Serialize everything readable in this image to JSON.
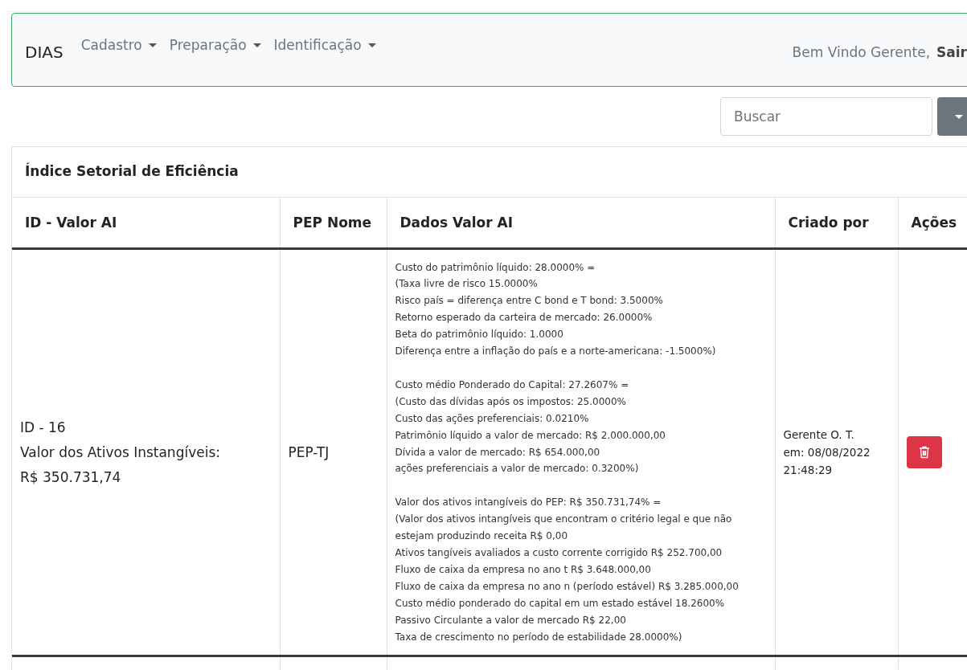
{
  "navbar": {
    "brand": "DIAS",
    "menus": [
      {
        "label": "Cadastro"
      },
      {
        "label": "Preparação"
      },
      {
        "label": "Identificação"
      }
    ],
    "greeting": "Bem Vindo Gerente,",
    "logout": "Sair"
  },
  "search": {
    "placeholder": "Buscar"
  },
  "card": {
    "title": "Índice Setorial de Eficiência",
    "table": {
      "columns": [
        "ID - Valor AI",
        "PEP Nome",
        "Dados Valor AI",
        "Criado por",
        "Ações"
      ],
      "rows": [
        {
          "id_lines": [
            "ID - 16",
            "Valor dos Ativos Instangíveis:",
            "R$ 350.731,74"
          ],
          "pep": "PEP-TJ",
          "data_groups": [
            [
              "Custo do patrimônio líquido: 28.0000% =",
              "(Taxa livre de risco 15.0000%",
              "Risco país = diferença entre C bond e T bond: 3.5000%",
              "Retorno esperado da carteira de mercado: 26.0000%",
              "Beta do patrimônio líquido: 1.0000",
              "Diferença entre a inflação do país e a norte-americana: -1.5000%)"
            ],
            [
              "Custo médio Ponderado do Capital: 27.2607% =",
              "(Custo das dívidas após os impostos: 25.0000%",
              "Custo das ações preferenciais: 0.0210%",
              "Patrimônio líquido a valor de mercado: R$ 2.000.000,00",
              "Dívida a valor de mercado: R$ 654.000,00",
              "ações preferenciais a valor de mercado: 0.3200%)"
            ],
            [
              "Valor dos ativos intangíveis do PEP: R$ 350.731,74% =",
              "(Valor dos ativos intangíveis que encontram o critério legal e que não estejam produzindo receita R$ 0,00",
              "Ativos tangíveis avaliados a custo corrente corrigido R$ 252.700,00",
              "Fluxo de caixa da empresa no ano t R$ 3.648.000,00",
              "Fluxo de caixa da empresa no ano n (período estável) R$ 3.285.000,00",
              "Custo médio ponderado do capital em um estado estável 18.2600%",
              "Passivo Circulante a valor de mercado R$ 22,00",
              "Taxa de crescimento no período de estabilidade 28.0000%)"
            ]
          ],
          "created_lines": [
            "Gerente O. T.",
            "em: 08/08/2022",
            "21:48:29"
          ],
          "actions": [
            {
              "kind": "delete"
            }
          ]
        }
      ]
    }
  }
}
